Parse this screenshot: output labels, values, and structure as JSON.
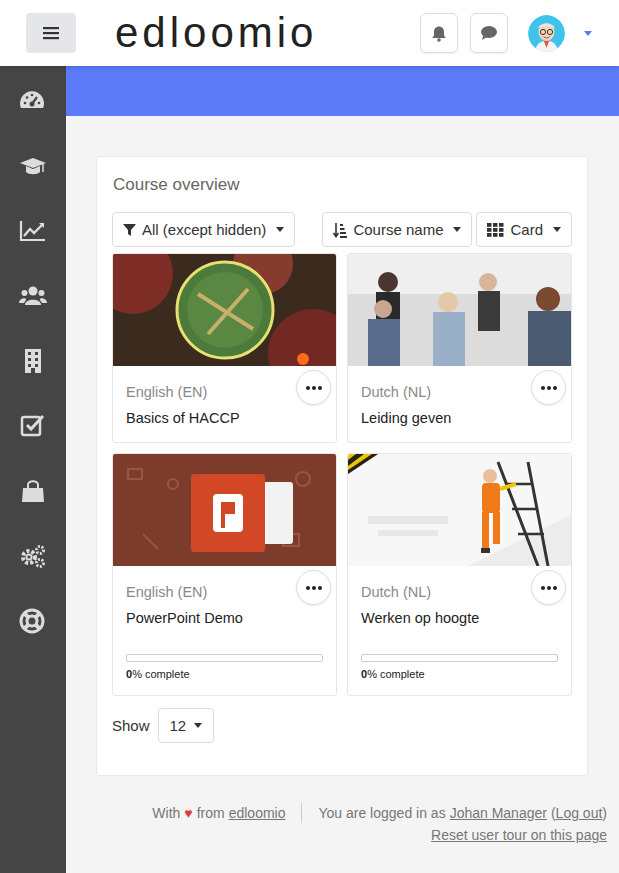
{
  "header": {
    "logo": "edloomio"
  },
  "course_overview": {
    "title": "Course overview",
    "filter": "All (except hidden)",
    "sort": "Course name",
    "view": "Card"
  },
  "courses": [
    {
      "kind": "plain",
      "category": "English (EN)",
      "name": "Basics of HACCP"
    },
    {
      "kind": "plain",
      "category": "Dutch (NL)",
      "name": "Leiding geven"
    },
    {
      "kind": "progress",
      "category": "English (EN)",
      "name": "PowerPoint Demo",
      "level": 0,
      "percent": "0",
      "reading": "% complete"
    },
    {
      "kind": "progress",
      "category": "Dutch (NL)",
      "name": "Werken op hoogte",
      "level": 0,
      "percent": "0",
      "reading": "% complete"
    }
  ],
  "paging": {
    "label": "Show",
    "value": "12"
  },
  "footer": {
    "with": "With",
    "heart": "♥",
    "from": "from",
    "brand": "edloomio",
    "logged_in": "You are logged in as",
    "user": "Johan Manager",
    "open_paren": "(",
    "logout": "Log out",
    "close_paren": ")",
    "reset_tour": "Reset user tour on this page"
  }
}
